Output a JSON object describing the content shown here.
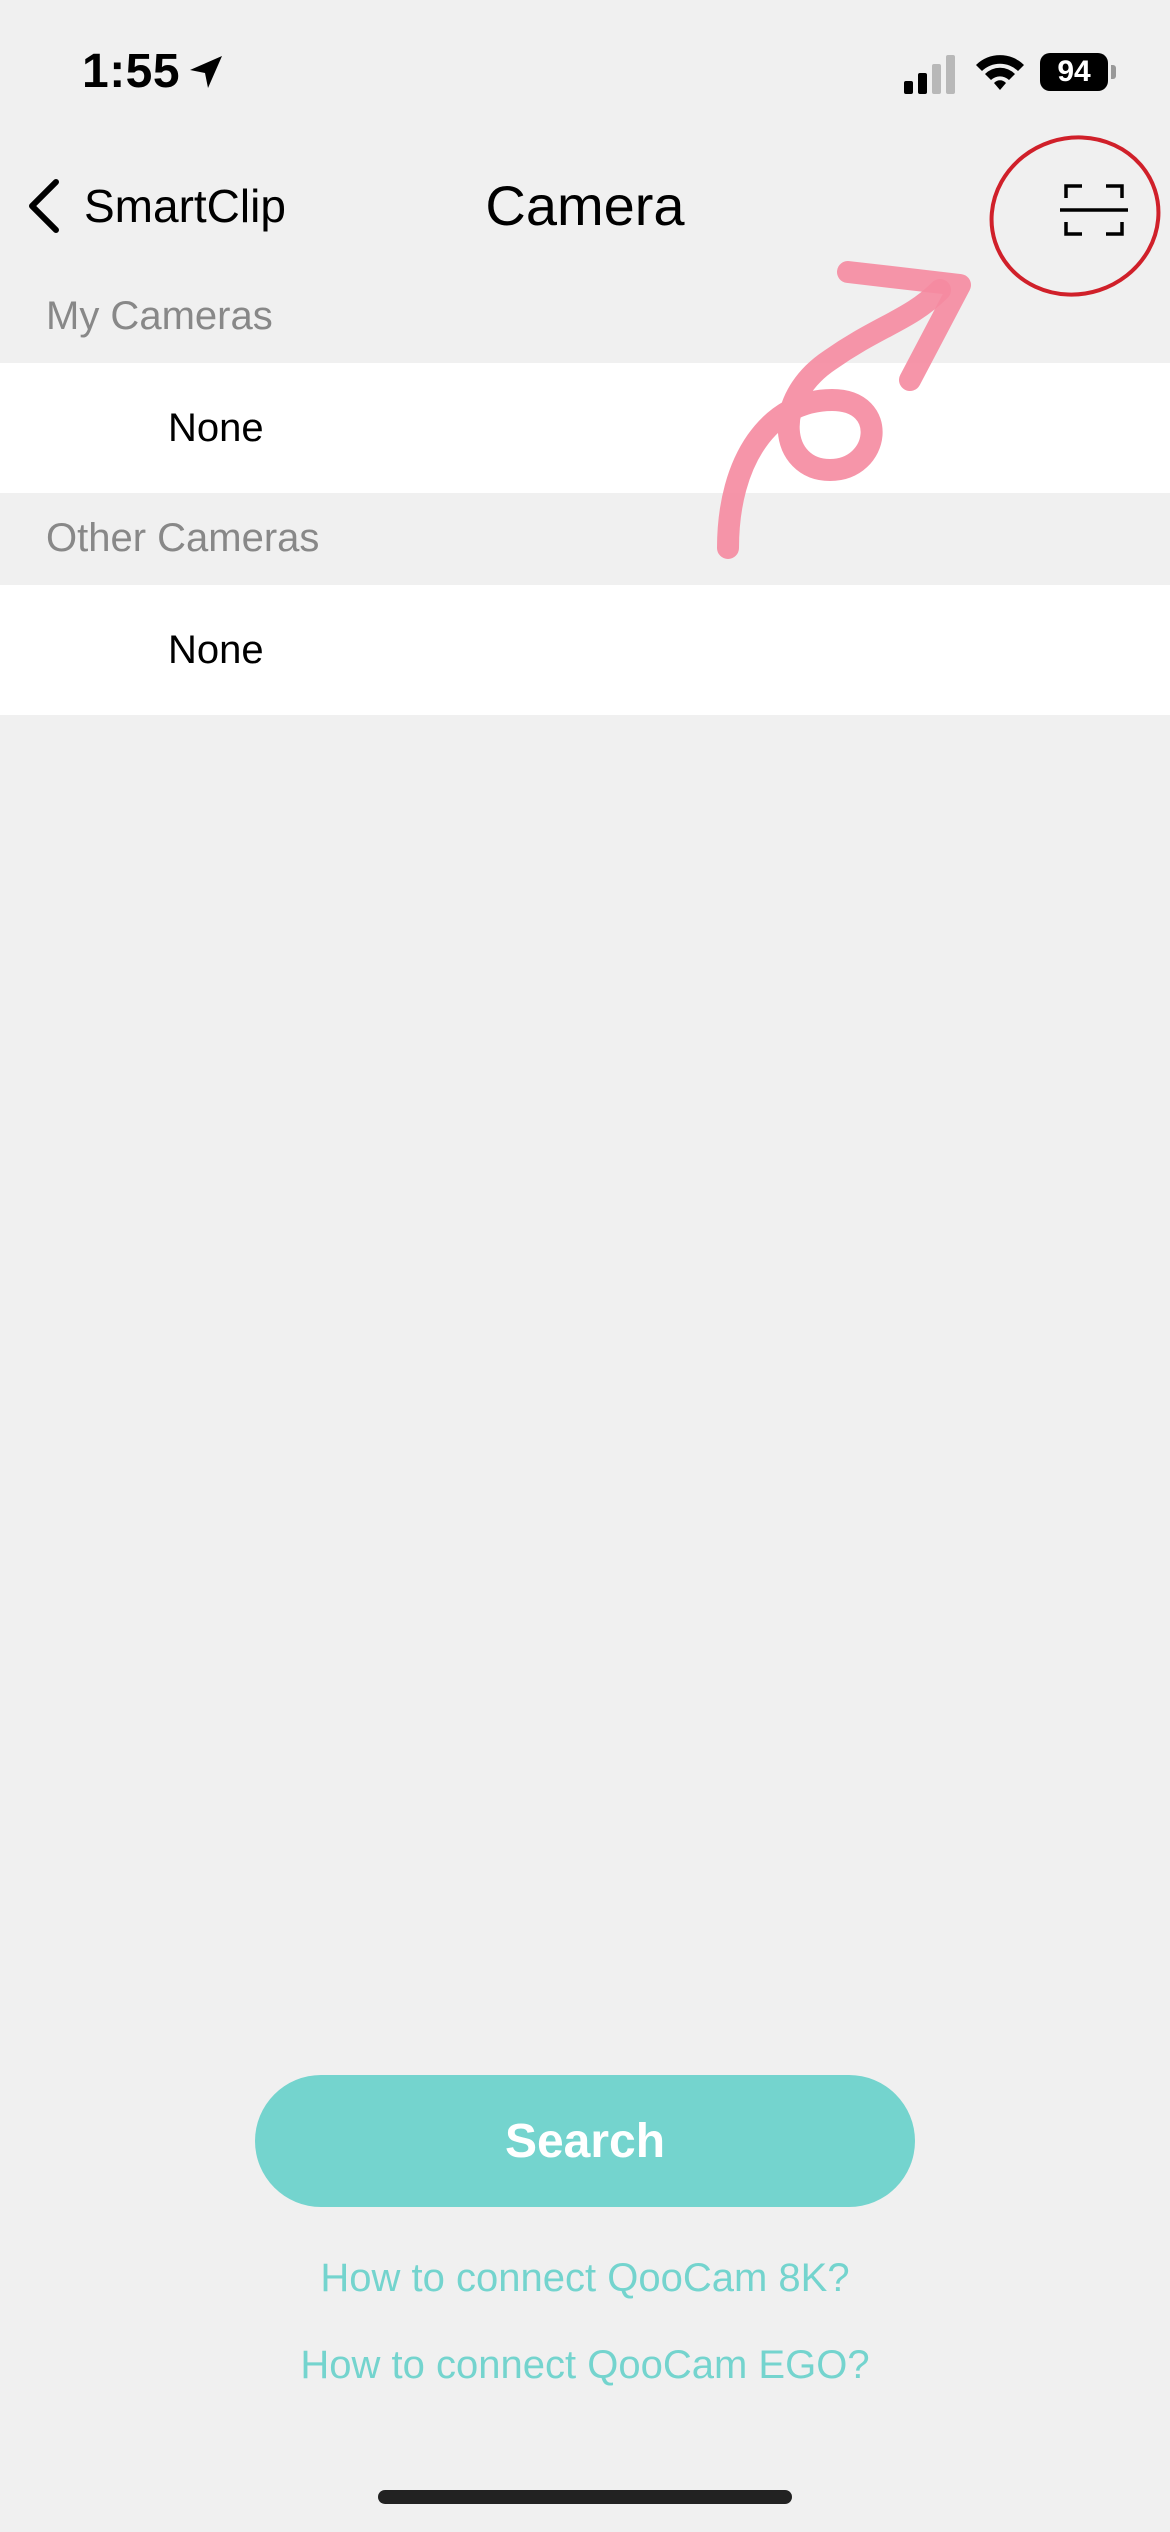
{
  "status_bar": {
    "time": "1:55",
    "battery": "94"
  },
  "nav": {
    "back_label": "SmartClip",
    "title": "Camera"
  },
  "sections": [
    {
      "header": "My Cameras",
      "row": "None"
    },
    {
      "header": "Other Cameras",
      "row": "None"
    }
  ],
  "actions": {
    "search_label": "Search",
    "help_links": [
      "How to connect QooCam 8K?",
      "How to connect QooCam EGO?"
    ]
  },
  "colors": {
    "accent": "#74d4ce",
    "annotation_circle": "#d0202a",
    "annotation_arrow": "#f58aa0"
  },
  "icons": {
    "back": "chevron-left-icon",
    "scan": "qr-scan-icon",
    "location": "location-arrow-icon",
    "signal": "cellular-signal-icon",
    "wifi": "wifi-icon"
  }
}
